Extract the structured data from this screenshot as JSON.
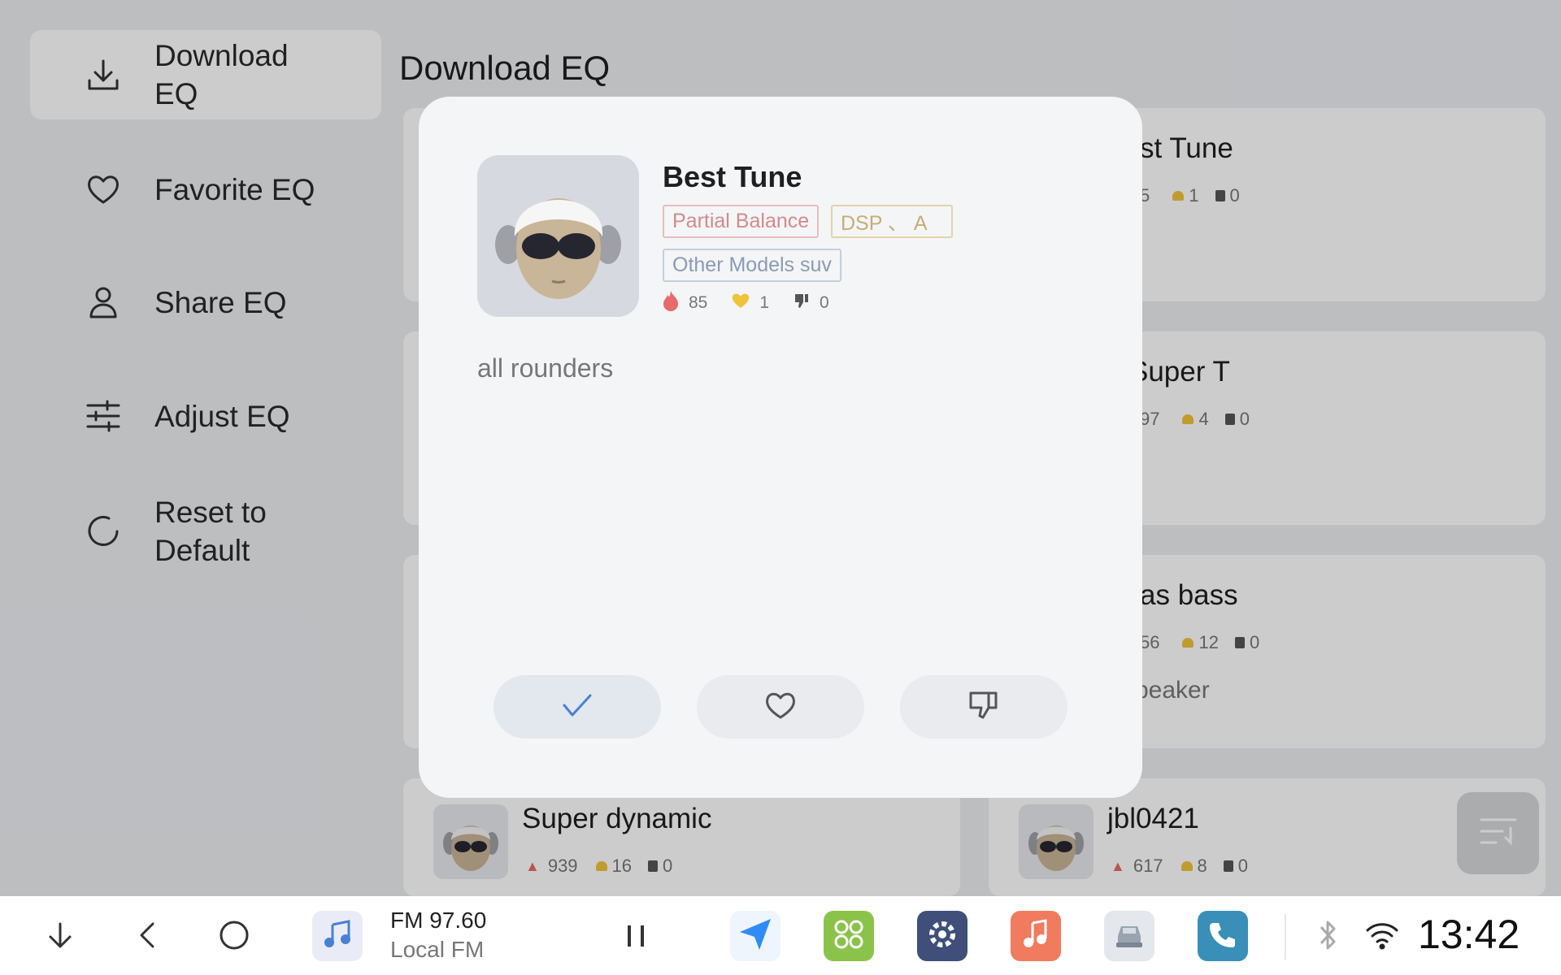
{
  "sidebar": {
    "items": [
      {
        "label": "Download EQ",
        "icon": "download-icon",
        "active": true
      },
      {
        "label": "Favorite EQ",
        "icon": "heart-icon",
        "active": false
      },
      {
        "label": "Share EQ",
        "icon": "user-icon",
        "active": false
      },
      {
        "label": "Adjust EQ",
        "icon": "sliders-icon",
        "active": false
      },
      {
        "label": "Reset to Default",
        "icon": "reset-icon",
        "active": false
      }
    ]
  },
  "main": {
    "title": "Download EQ",
    "cards": [
      {
        "name": "st Tune",
        "views": "5",
        "likes": "1",
        "dislikes": "0",
        "extra": ""
      },
      {
        "name": "Super T",
        "views": "97",
        "likes": "4",
        "dislikes": "0",
        "extra": ""
      },
      {
        "name": "as bass",
        "views": "56",
        "likes": "12",
        "dislikes": "0",
        "extra": "beaker"
      },
      {
        "name": "Super dynamic",
        "views": "939",
        "likes": "16",
        "dislikes": "0",
        "extra": ""
      },
      {
        "name": "jbl0421",
        "views": "617",
        "likes": "8",
        "dislikes": "0",
        "extra": ""
      }
    ]
  },
  "dialog": {
    "title": "Best Tune",
    "tags": [
      "Partial Balance",
      "DSP 、 A",
      "Other Models suv"
    ],
    "views": "85",
    "likes": "1",
    "dislikes": "0",
    "description": "all rounders"
  },
  "taskbar": {
    "radio_freq": "FM 97.60",
    "radio_name": "Local FM",
    "time": "13:42"
  },
  "colors": {
    "accent_blue": "#4a7fd6",
    "fire": "#e86a6a",
    "like": "#f0c33c",
    "maps": "#2f8cf5",
    "apps": "#8bc34a",
    "settings": "#3f4f7a",
    "music": "#f07b5e",
    "phone": "#3a8fb8"
  }
}
